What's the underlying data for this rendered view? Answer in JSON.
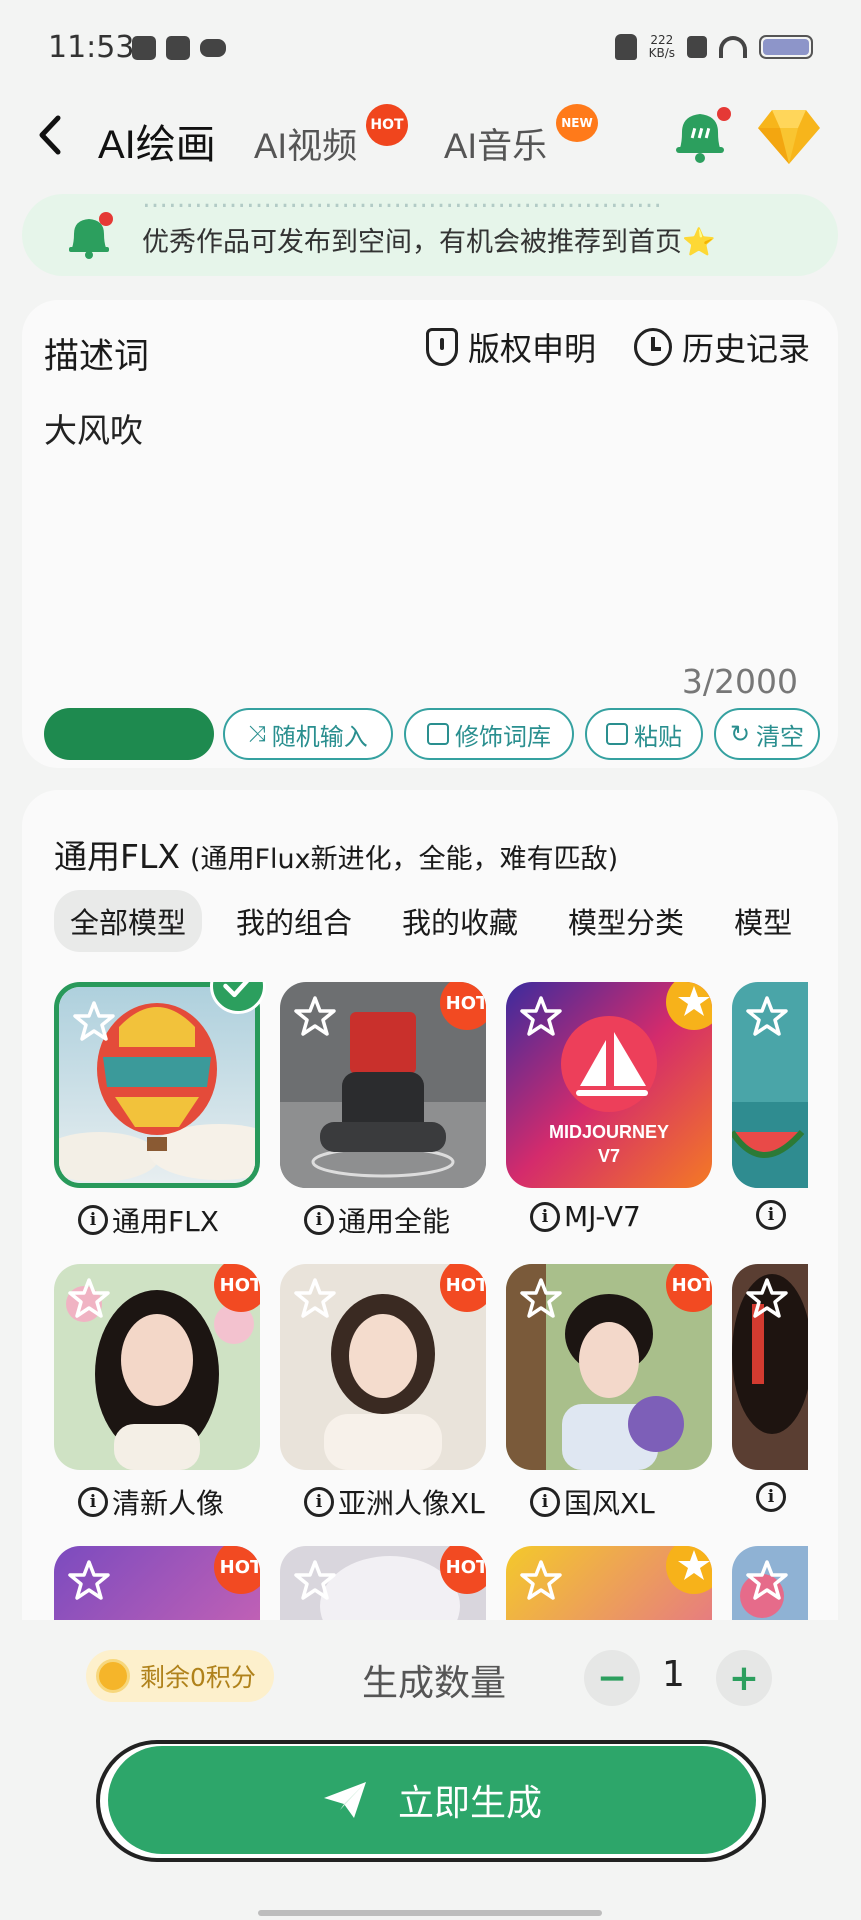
{
  "status_bar": {
    "time": "11:53",
    "net_speed_value": "222",
    "net_speed_unit": "KB/s"
  },
  "header": {
    "active_tab": "AI绘画",
    "video_tab": "AI视频",
    "video_badge": "HOT",
    "music_tab": "AI音乐",
    "music_badge": "NEW"
  },
  "notice": {
    "text": "优秀作品可发布到空间，有机会被推荐到首页⭐"
  },
  "prompt": {
    "title": "描述词",
    "copyright_label": "版权申明",
    "history_label": "历史记录",
    "value": "大风吹",
    "counter": "3/2000",
    "chips": {
      "random": "随机输入",
      "modifier": "修饰词库",
      "paste": "粘贴",
      "clear": "清空"
    }
  },
  "models": {
    "title": "通用FLX",
    "subtitle": "(通用Flux新进化，全能，难有匹敌)",
    "tabs": [
      "全部模型",
      "我的组合",
      "我的收藏",
      "模型分类",
      "模型"
    ],
    "items": [
      {
        "label": "通用FLX",
        "badge": ""
      },
      {
        "label": "通用全能",
        "badge": "HOT"
      },
      {
        "label": "MJ-V7",
        "badge": ""
      },
      {
        "label": "清新人像",
        "badge": "HOT"
      },
      {
        "label": "亚洲人像XL",
        "badge": "HOT"
      },
      {
        "label": "国风XL",
        "badge": "HOT"
      },
      {
        "label": "",
        "badge": "HOT"
      },
      {
        "label": "",
        "badge": "HOT"
      }
    ],
    "mj_logo_line1": "MIDJOURNEY",
    "mj_logo_line2": "V7"
  },
  "bottom": {
    "points": "剩余0积分",
    "quantity_label": "生成数量",
    "quantity": "1",
    "generate_label": "立即生成"
  },
  "colors": {
    "brand_green": "#2da66a",
    "hot_red": "#f24a22",
    "teal_chip": "#35a1a0"
  }
}
